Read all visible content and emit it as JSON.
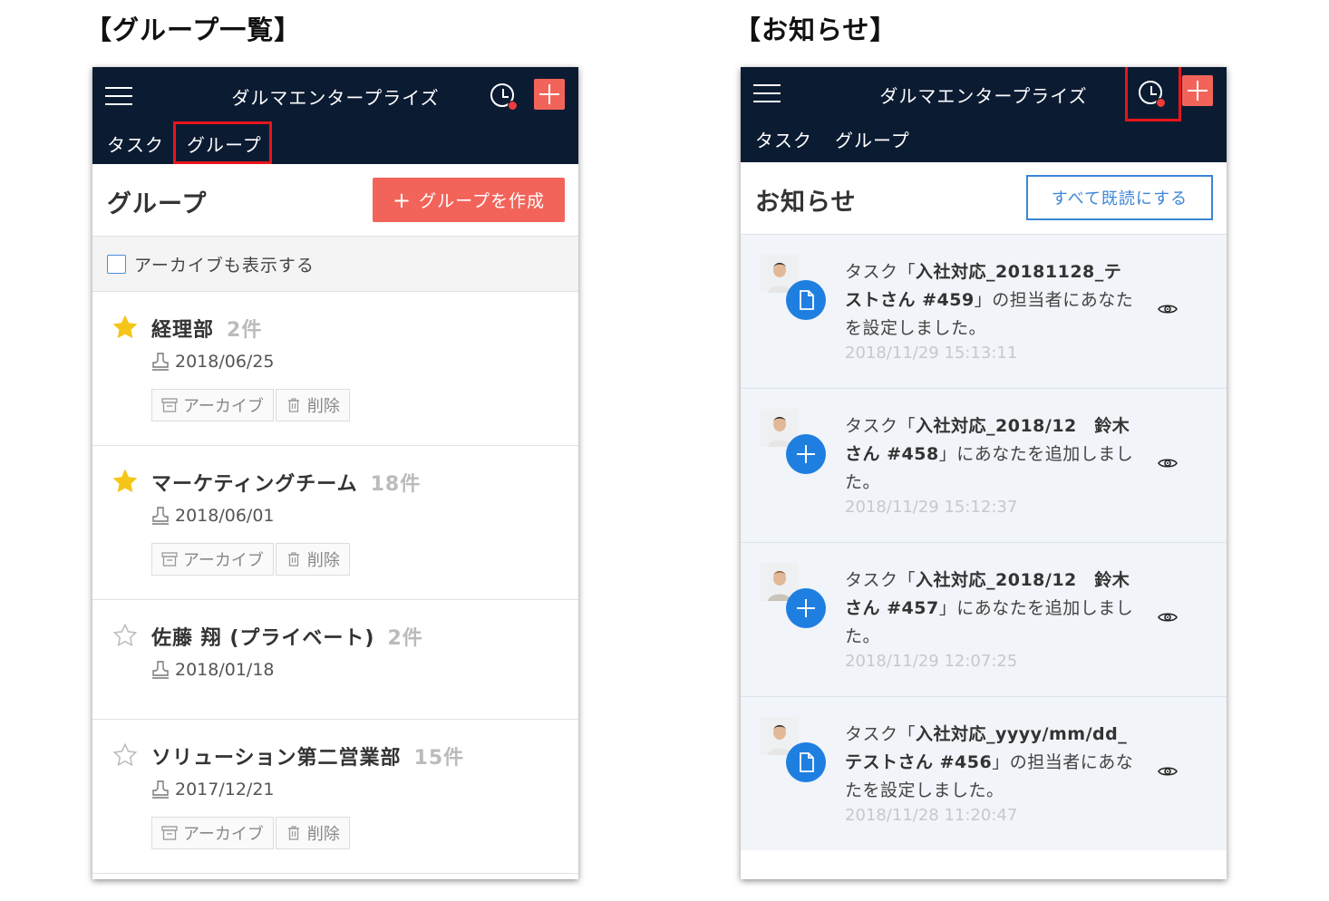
{
  "captions": {
    "left": "【グループ一覧】",
    "right": "【お知らせ】"
  },
  "app": {
    "title": "ダルマエンタープライズ",
    "nav_tasks": "タスク",
    "nav_groups": "グループ",
    "header_bg": "#0b1b32",
    "accent": "#f2645a",
    "highlight": "#e8141b"
  },
  "groups_page": {
    "title": "グループ",
    "create_label": "グループを作成",
    "archive_toggle_label": "アーカイブも表示する",
    "archive_button": "アーカイブ",
    "delete_button": "削除",
    "items": [
      {
        "name": "経理部",
        "count": "2件",
        "date": "2018/06/25",
        "starred": true,
        "actions": true
      },
      {
        "name": "マーケティングチーム",
        "count": "18件",
        "date": "2018/06/01",
        "starred": true,
        "actions": true
      },
      {
        "name": "佐藤 翔 (プライベート)",
        "count": "2件",
        "date": "2018/01/18",
        "starred": false,
        "actions": false
      },
      {
        "name": "ソリューション第二営業部",
        "count": "15件",
        "date": "2017/12/21",
        "starred": false,
        "actions": true
      }
    ]
  },
  "notifications_page": {
    "title": "お知らせ",
    "mark_all_read": "すべて既読にする",
    "items": [
      {
        "prefix": "タスク「",
        "task": "入社対応_20181128_テストさん #459",
        "suffix": "」の担当者にあなたを設定しました。",
        "time": "2018/11/29 15:13:11",
        "badge_icon": "document-icon"
      },
      {
        "prefix": "タスク「",
        "task": "入社対応_2018/12　鈴木さん #458",
        "suffix": "」にあなたを追加しました。",
        "time": "2018/11/29 15:12:37",
        "badge_icon": "plus-icon"
      },
      {
        "prefix": "タスク「",
        "task": "入社対応_2018/12　鈴木さん #457",
        "suffix": "」にあなたを追加しました。",
        "time": "2018/11/29 12:07:25",
        "badge_icon": "plus-icon"
      },
      {
        "prefix": "タスク「",
        "task": "入社対応_yyyy/mm/dd_テストさん #456",
        "suffix": "」の担当者にあなたを設定しました。",
        "time": "2018/11/28 11:20:47",
        "badge_icon": "document-icon"
      }
    ]
  }
}
